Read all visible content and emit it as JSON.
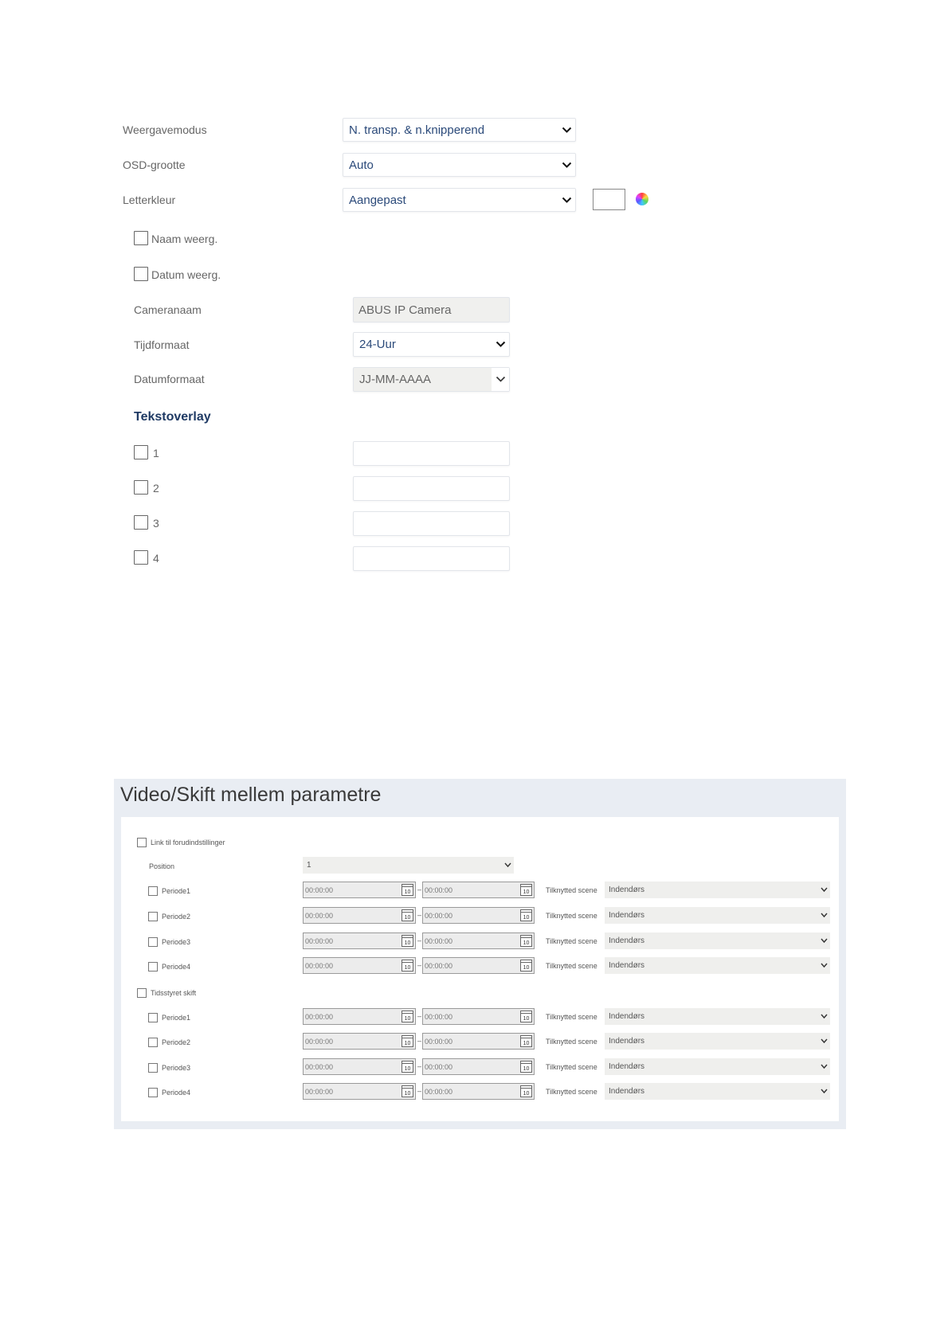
{
  "osd": {
    "weergavemodus": {
      "label": "Weergavemodus",
      "value": "N. transp. & n.knipperend"
    },
    "osd_grootte": {
      "label": "OSD-grootte",
      "value": "Auto"
    },
    "letterkleur": {
      "label": "Letterkleur",
      "value": "Aangepast"
    },
    "naam_weerg": "Naam weerg.",
    "datum_weerg": "Datum weerg.",
    "cameranaam": {
      "label": "Cameranaam",
      "value": "ABUS IP Camera"
    },
    "tijdformaat": {
      "label": "Tijdformaat",
      "value": "24-Uur"
    },
    "datumformaat": {
      "label": "Datumformaat",
      "value": "JJ-MM-AAAA"
    }
  },
  "tekstoverlay": {
    "heading": "Tekstoverlay",
    "items": [
      {
        "label": "1",
        "value": ""
      },
      {
        "label": "2",
        "value": ""
      },
      {
        "label": "3",
        "value": ""
      },
      {
        "label": "4",
        "value": ""
      }
    ]
  },
  "panel": {
    "title": "Video/Skift mellem parametre",
    "link_preset_label": "Link til forudindstillinger",
    "position_label": "Position",
    "position_value": "1",
    "timed_switch_label": "Tidsstyret skift",
    "calendar_icon_text": "10",
    "dash": "–",
    "scene_label": "Tilknytted scene",
    "preset_periods": [
      {
        "label": "Periode1",
        "start": "00:00:00",
        "end": "00:00:00",
        "scene": "Indendørs"
      },
      {
        "label": "Periode2",
        "start": "00:00:00",
        "end": "00:00:00",
        "scene": "Indendørs"
      },
      {
        "label": "Periode3",
        "start": "00:00:00",
        "end": "00:00:00",
        "scene": "Indendørs"
      },
      {
        "label": "Periode4",
        "start": "00:00:00",
        "end": "00:00:00",
        "scene": "Indendørs"
      }
    ],
    "timed_periods": [
      {
        "label": "Periode1",
        "start": "00:00:00",
        "end": "00:00:00",
        "scene": "Indendørs"
      },
      {
        "label": "Periode2",
        "start": "00:00:00",
        "end": "00:00:00",
        "scene": "Indendørs"
      },
      {
        "label": "Periode3",
        "start": "00:00:00",
        "end": "00:00:00",
        "scene": "Indendørs"
      },
      {
        "label": "Periode4",
        "start": "00:00:00",
        "end": "00:00:00",
        "scene": "Indendørs"
      }
    ]
  }
}
